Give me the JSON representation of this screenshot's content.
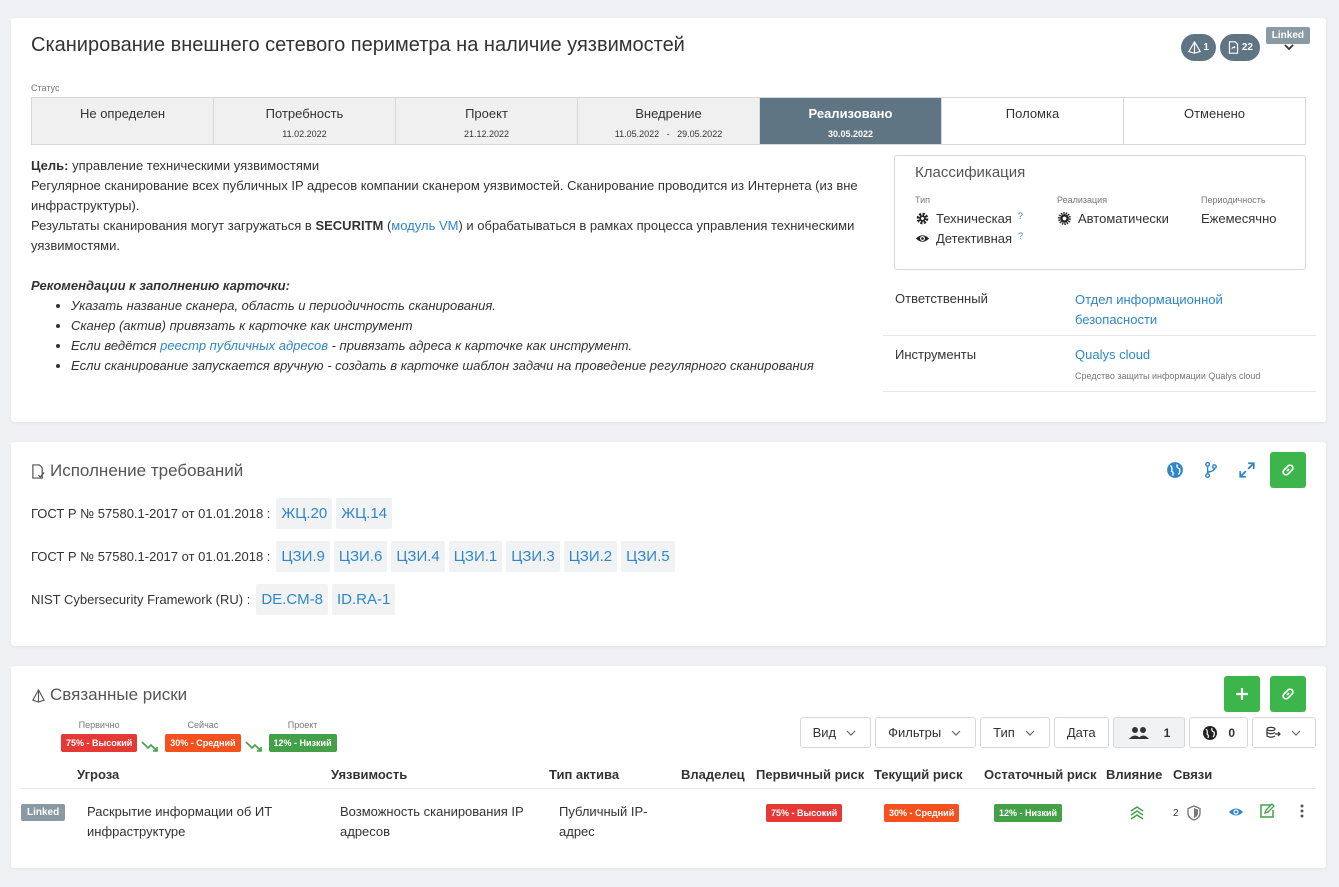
{
  "header": {
    "linked": "Linked",
    "title": "Сканирование внешнего сетевого периметра на наличие уязвимостей",
    "badge_risks": "1",
    "badge_docs": "22"
  },
  "status": {
    "label": "Статус",
    "stages": [
      {
        "name": "Не определен",
        "date": ""
      },
      {
        "name": "Потребность",
        "date": "11.02.2022"
      },
      {
        "name": "Проект",
        "date": "21.12.2022"
      },
      {
        "name": "Внедрение",
        "date": "11.05.2022   -   29.05.2022"
      },
      {
        "name": "Реализовано",
        "date": "30.05.2022"
      },
      {
        "name": "Поломка",
        "date": ""
      },
      {
        "name": "Отменено",
        "date": ""
      }
    ],
    "active": "Реализовано"
  },
  "description": {
    "goal_label": "Цель:",
    "goal_text": " управление техническими уязвимостями",
    "p1": "Регулярное сканирование всех публичных IP адресов компании сканером уязвимостей. Сканирование проводится из Интернета (из вне инфраструктуры).",
    "p2_a": "Результаты сканирования могут загружаться в ",
    "p2_bold": "SECURITM",
    "p2_b": " (",
    "p2_link": "модуль VM",
    "p2_c": ") и обрабатываться в рамках процесса управления техническими уязвимостями.",
    "rec_title": "Рекомендации к заполнению карточки:",
    "rec1": "Указать название сканера, область и периодичность сканирования.",
    "rec2": "Сканер (актив) привязать к карточке как инструмент",
    "rec3_a": "Если ведётся ",
    "rec3_link": "реестр публичных адресов",
    "rec3_b": " - привязать адреса к карточке как инструмент.",
    "rec4": "Если сканирование запускается вручную - создать в карточке шаблон задачи на проведение регулярного сканирования"
  },
  "classification": {
    "title": "Классификация",
    "type_label": "Тип",
    "type1": "Техническая",
    "type2": "Детективная",
    "q": "?",
    "impl_label": "Реализация",
    "impl_value": "Автоматически",
    "period_label": "Периодичность",
    "period_value": "Ежемесячно"
  },
  "responsible": {
    "label": "Ответственный",
    "value": "Отдел информационной безопасности"
  },
  "tools": {
    "label": "Инструменты",
    "value": "Qualys cloud",
    "sub": "Средство защиты информации Qualys cloud"
  },
  "requirements": {
    "title": "Исполнение требований",
    "rows": [
      {
        "label": "ГОСТ Р № 57580.1-2017 от 01.01.2018 :",
        "chips": [
          "ЖЦ.20",
          "ЖЦ.14"
        ]
      },
      {
        "label": "ГОСТ Р № 57580.1-2017 от 01.01.2018 :",
        "chips": [
          "ЦЗИ.9",
          "ЦЗИ.6",
          "ЦЗИ.4",
          "ЦЗИ.1",
          "ЦЗИ.3",
          "ЦЗИ.2",
          "ЦЗИ.5"
        ]
      },
      {
        "label": "NIST Cybersecurity Framework (RU) :",
        "chips": [
          "DE.CM-8",
          "ID.RA-1"
        ]
      }
    ]
  },
  "risks": {
    "title": "Связанные риски",
    "levels": {
      "primary_label": "Первично",
      "primary": "75% - Высокий",
      "now_label": "Сейчас",
      "now": "30% - Средний",
      "project_label": "Проект",
      "project": "12% - Низкий"
    },
    "filters": {
      "view": "Вид",
      "filters": "Фильтры",
      "type": "Тип",
      "date": "Дата",
      "people_count": "1",
      "globe_count": "0"
    },
    "columns": {
      "threat": "Угроза",
      "vuln": "Уязвимость",
      "asset": "Тип актива",
      "owner": "Владелец",
      "primary": "Первичный риск",
      "current": "Текущий риск",
      "residual": "Остаточный риск",
      "impact": "Влияние",
      "links": "Связи"
    },
    "row": {
      "tag": "Linked",
      "threat": "Раскрытие информации об ИТ инфраструктуре",
      "vuln": "Возможность сканирования IP адресов",
      "asset": "Публичный IP-адрес",
      "owner": "",
      "primary": "75% - Высокий",
      "current": "30% - Средний",
      "residual": "12% - Низкий",
      "links_count": "2"
    }
  },
  "colors": {
    "active_stage": "#5f7584",
    "link": "#2f86c9",
    "green": "#3cb54a",
    "red": "#e53935",
    "orange": "#f4511e"
  }
}
